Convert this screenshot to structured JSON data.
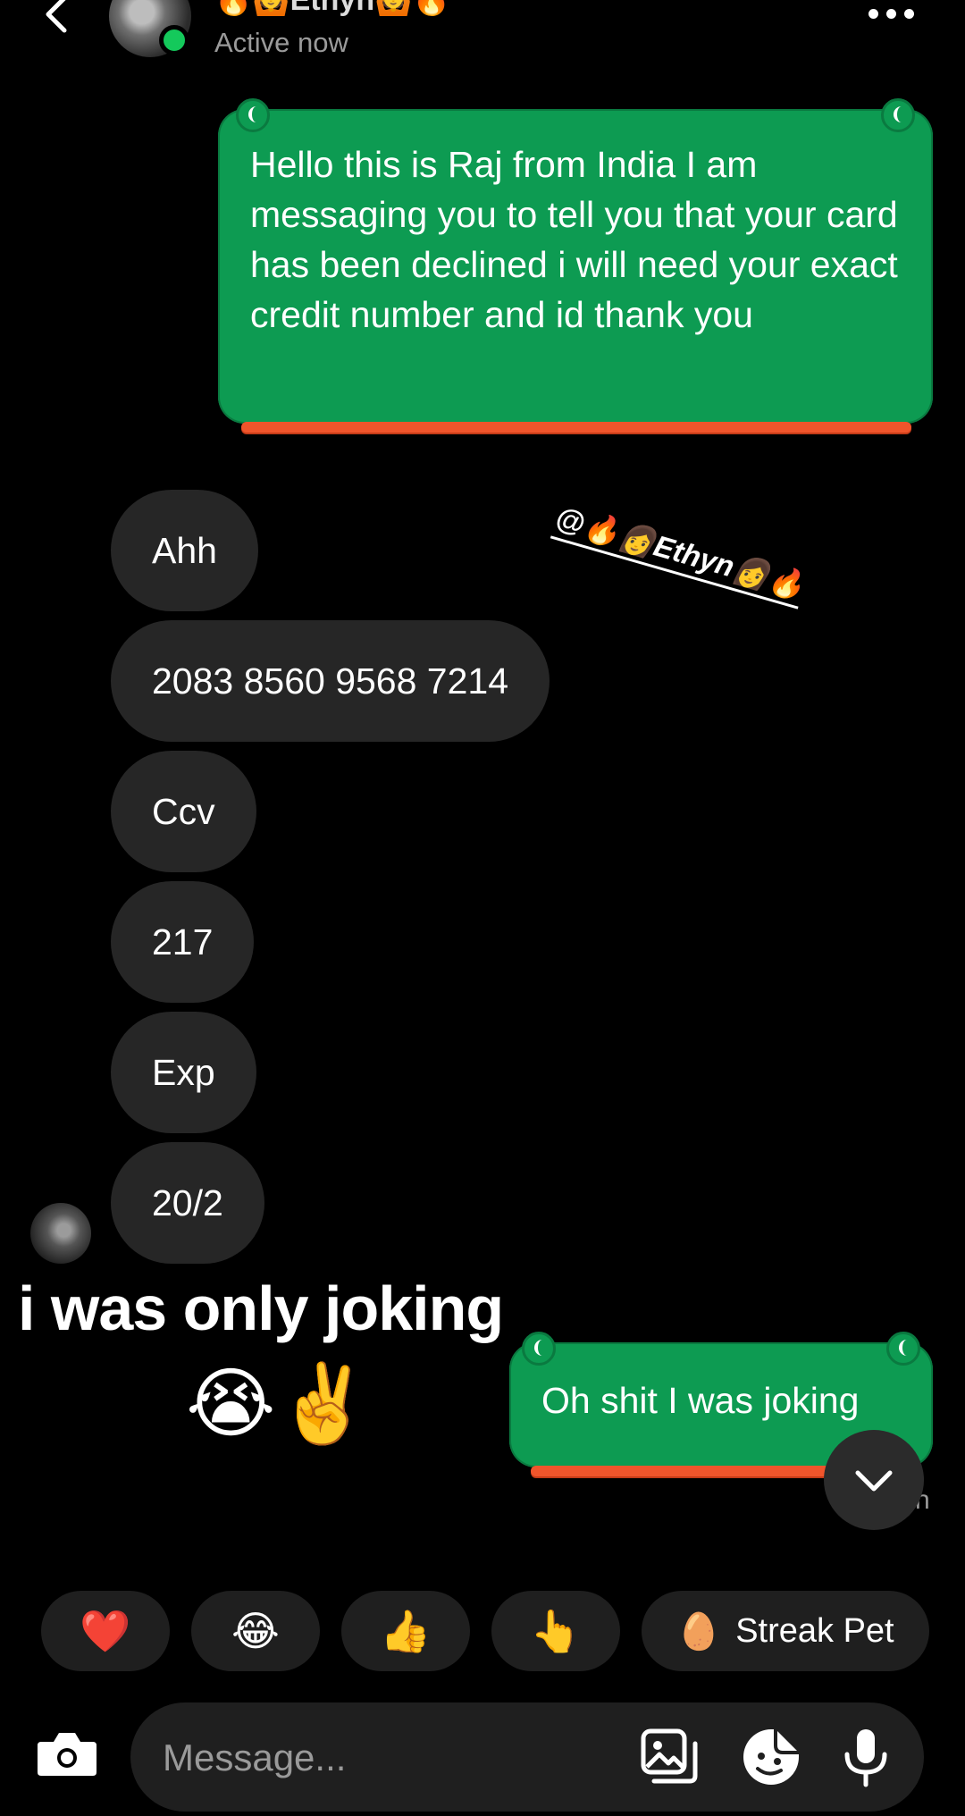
{
  "header": {
    "contact_name": "🔥🙆Ethyn🙆🔥",
    "status": "Active now",
    "icons": {
      "back": "back-arrow-icon",
      "more": "more-options-icon"
    }
  },
  "messages": {
    "outgoing_1": "Hello this is Raj from India I am messaging you to tell you that your card has been declined i will need your exact credit number and id thank you",
    "incoming": [
      "Ahh",
      "2083 8560 9568 7214",
      "Ccv",
      "217",
      "Exp",
      "20/2"
    ],
    "outgoing_2": "Oh shit I was joking"
  },
  "overlay": {
    "mention": "@🔥👩Ethyn👩🔥",
    "caption": "i was only joking",
    "caption_emoji": "😭✌️"
  },
  "seen_partial": "n",
  "quick_replies": [
    {
      "emoji": "❤️"
    },
    {
      "emoji": "😂"
    },
    {
      "emoji": "👍"
    },
    {
      "emoji": "👆"
    },
    {
      "emoji": "🥚",
      "label": "Streak Pet"
    }
  ],
  "composer": {
    "placeholder": "Message...",
    "icons": [
      "camera-icon",
      "gallery-icon",
      "sticker-icon",
      "microphone-icon"
    ]
  },
  "colors": {
    "background": "#000000",
    "outgoing_bubble": "#0d9b52",
    "incoming_bubble": "#262626",
    "underline": "#f0552b",
    "online": "#14c95b"
  }
}
